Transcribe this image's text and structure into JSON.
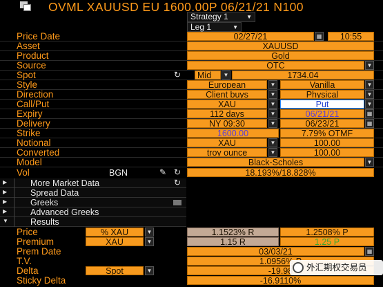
{
  "title_bar": {
    "text": "OVML XAUUSD EU 1600.00P 06/21/21 N100"
  },
  "top": {
    "strategy": "Strategy 1",
    "leg": "Leg 1"
  },
  "fields": {
    "price_date": {
      "label": "Price Date",
      "date": "02/27/21",
      "time": "10:55"
    },
    "asset": {
      "label": "Asset",
      "value": "XAUUSD"
    },
    "product": {
      "label": "Product",
      "value": "Gold"
    },
    "source": {
      "label": "Source",
      "value": "OTC"
    },
    "spot": {
      "label": "Spot",
      "mode": "Mid",
      "value": "1734.04"
    },
    "style": {
      "label": "Style",
      "a": "European",
      "b": "Vanilla"
    },
    "direction": {
      "label": "Direction",
      "a": "Client buys",
      "b": "Physical"
    },
    "callput": {
      "label": "Call/Put",
      "a": "XAU",
      "b": "Put"
    },
    "expiry": {
      "label": "Expiry",
      "a": "112 days",
      "b": "06/21/21"
    },
    "delivery": {
      "label": "Delivery",
      "a": "NY 09:30",
      "b": "06/23/21"
    },
    "strike": {
      "label": "Strike",
      "a": "1600.00",
      "b": "7.79% OTMF"
    },
    "notional": {
      "label": "Notional",
      "a": "XAU",
      "b": "100.00"
    },
    "converted": {
      "label": "Converted",
      "a": "troy ounce",
      "b": "100.00"
    },
    "model": {
      "label": "Model",
      "value": "Black-Scholes"
    },
    "vol": {
      "label": "Vol",
      "source": "BGN",
      "value": "18.193%/18.828%"
    }
  },
  "sections": [
    {
      "label": "More Market Data"
    },
    {
      "label": "Spread Data"
    },
    {
      "label": "Greeks"
    },
    {
      "label": "Advanced Greeks"
    },
    {
      "label": "Results"
    }
  ],
  "results": {
    "price": {
      "label": "Price",
      "unit": "% XAU",
      "a": "1.1523% R",
      "b": "1.2508% P"
    },
    "premium": {
      "label": "Premium",
      "unit": "XAU",
      "a": "1.15 R",
      "b": "1.25 P"
    },
    "prem_date": {
      "label": "Prem Date",
      "value": "03/03/21"
    },
    "tv": {
      "label": "T.V.",
      "value": "1.0956% P"
    },
    "delta": {
      "label": "Delta",
      "unit": "Spot",
      "value": "-19.98"
    },
    "sticky_delta": {
      "label": "Sticky Delta",
      "value": "-16.9110%"
    }
  },
  "watermark": {
    "text": "外汇期权交易员"
  },
  "colors": {
    "orange": "#f79a1e",
    "label": "#ff9a1a",
    "grey_box": "#c3a995",
    "blue_text": "#5a3fd8",
    "green_text": "#3aa832"
  }
}
